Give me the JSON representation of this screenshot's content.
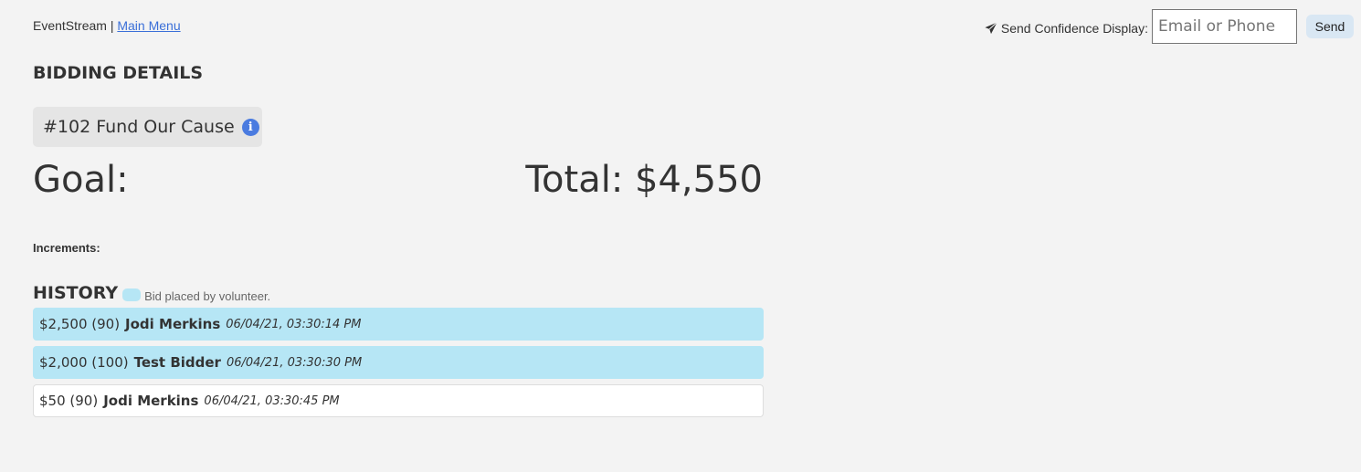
{
  "nav": {
    "app_name": "EventStream",
    "separator": " | ",
    "main_menu_link": "Main Menu"
  },
  "send": {
    "label": "Send Confidence Display:",
    "input_value": "",
    "input_placeholder": "Email or Phone",
    "button_label": "Send",
    "icon": "paper-plane-icon"
  },
  "page": {
    "section_title": "BIDDING DETAILS",
    "item_label": "#102 Fund Our Cause",
    "info_icon": "info-icon",
    "goal_label": "Goal:",
    "total_label": "Total: $4,550",
    "increments_label": "Increments:"
  },
  "history": {
    "title": "HISTORY",
    "legend_text": "Bid placed by volunteer.",
    "volunteer_color": "#b6e6f5",
    "bids": [
      {
        "amount": "$2,500 (90)",
        "bidder": "Jodi Merkins",
        "time": "06/04/21, 03:30:14 PM",
        "volunteer": true
      },
      {
        "amount": "$2,000 (100)",
        "bidder": "Test Bidder",
        "time": "06/04/21, 03:30:30 PM",
        "volunteer": true
      },
      {
        "amount": "$50 (90)",
        "bidder": "Jodi Merkins",
        "time": "06/04/21, 03:30:45 PM",
        "volunteer": false
      }
    ]
  }
}
